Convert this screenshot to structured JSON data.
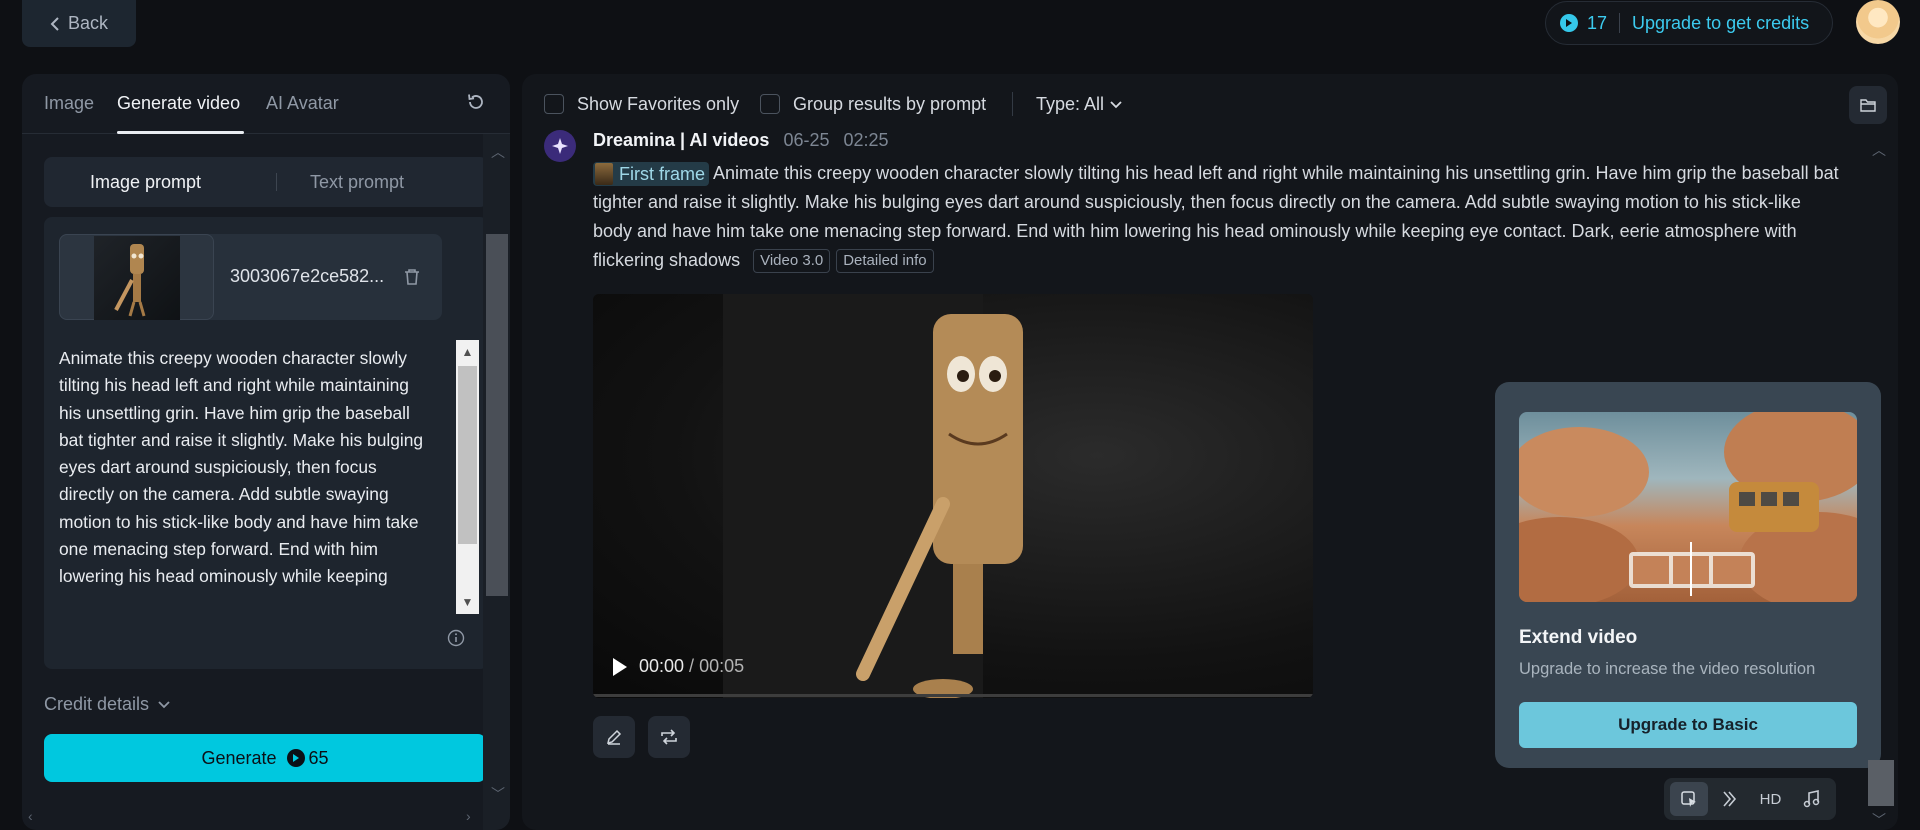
{
  "topbar": {
    "back_label": "Back",
    "credits": "17",
    "upgrade_label": "Upgrade to get credits"
  },
  "left": {
    "tabs": [
      {
        "label": "Image"
      },
      {
        "label": "Generate video"
      },
      {
        "label": "AI Avatar"
      }
    ],
    "prompt_modes": {
      "image": "Image prompt",
      "text": "Text prompt"
    },
    "file_name": "3003067e2ce582...",
    "prompt_text": "Animate this creepy wooden character slowly tilting his head left and right while maintaining his unsettling grin. Have him grip the baseball bat tighter and raise it slightly. Make his bulging eyes dart around suspiciously, then focus directly on the camera. Add subtle swaying motion to his stick-like body and have him take one menacing step forward. End with him lowering his head ominously while keeping",
    "credit_details": "Credit details",
    "generate_label": "Generate",
    "generate_cost": "65"
  },
  "main": {
    "filters": {
      "favorites": "Show Favorites only",
      "group": "Group results by prompt",
      "type": "Type: All"
    },
    "generation": {
      "title": "Dreamina | AI videos",
      "date": "06-25",
      "time": "02:25",
      "first_frame": "First frame",
      "prompt": "Animate this creepy wooden character slowly tilting his head left and right while maintaining his unsettling grin. Have him grip the baseball bat tighter and raise it slightly. Make his bulging eyes dart around suspiciously, then focus directly on the camera. Add subtle swaying motion to his stick-like body and have him take one menacing step forward. End with him lowering his head ominously while keeping eye contact. Dark, eerie atmosphere with flickering shadows",
      "model_tag": "Video 3.0",
      "detail_tag": "Detailed info",
      "time_current": "00:00",
      "time_sep": " / ",
      "time_total": "00:05"
    },
    "popup": {
      "title": "Extend video",
      "subtitle": "Upgrade to increase the video resolution",
      "button": "Upgrade to Basic"
    },
    "mini_toolbar": {
      "hd": "HD"
    }
  },
  "colors": {
    "accent": "#00c8df",
    "credit": "#3ccbef",
    "popup_button": "#6cc7dc"
  },
  "icons": [
    "chevron-left-icon",
    "credit-coin-icon",
    "refresh-icon",
    "trash-icon",
    "info-icon",
    "chevron-down-icon",
    "folder-icon",
    "dreamina-logo-icon",
    "play-icon",
    "edit-icon",
    "regenerate-icon",
    "extend-icon",
    "lip-sync-icon",
    "music-icon"
  ]
}
